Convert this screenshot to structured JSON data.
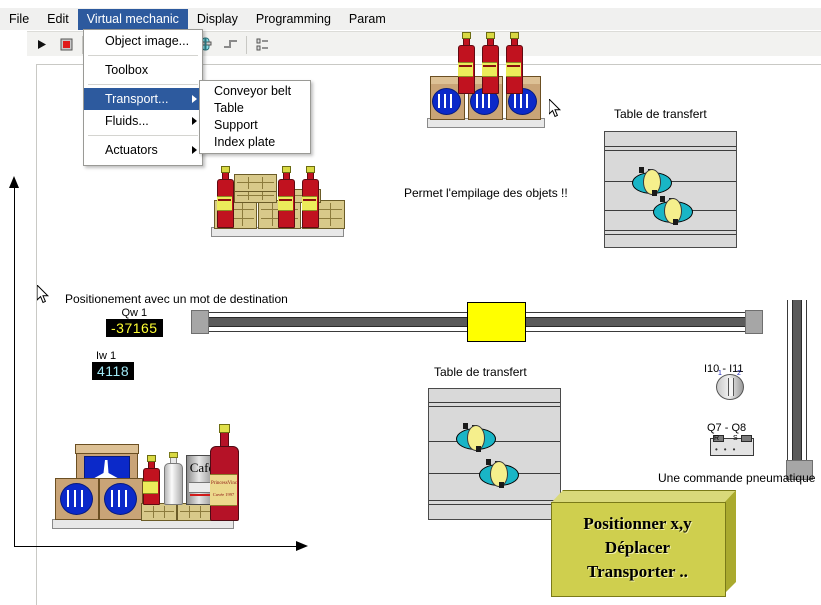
{
  "app": {
    "menubar": [
      {
        "label": "File",
        "active": false
      },
      {
        "label": "Edit",
        "active": false
      },
      {
        "label": "Virtual mechanic",
        "active": true
      },
      {
        "label": "Display",
        "active": false
      },
      {
        "label": "Programming",
        "active": false
      },
      {
        "label": "Param",
        "active": false
      }
    ]
  },
  "menus": {
    "virtual_mechanic": [
      {
        "label": "Object image...",
        "submenu": false,
        "highlighted": false
      },
      {
        "label": "Toolbox",
        "submenu": false,
        "highlighted": false
      },
      {
        "label": "Transport...",
        "submenu": true,
        "highlighted": true
      },
      {
        "label": "Fluids...",
        "submenu": true,
        "highlighted": false
      },
      {
        "label": "Actuators",
        "submenu": true,
        "highlighted": false
      }
    ],
    "transport": [
      {
        "label": "Conveyor belt"
      },
      {
        "label": "Table"
      },
      {
        "label": "Support"
      },
      {
        "label": "Index plate"
      }
    ]
  },
  "toolbar": {
    "icons": [
      {
        "name": "run-icon",
        "glyph": "▶"
      },
      {
        "name": "stop-icon",
        "glyph": "■"
      },
      {
        "name": "object-image-icon",
        "glyph": "▤"
      },
      {
        "name": "toolbox-icon",
        "glyph": "▥"
      },
      {
        "name": "conveyor-icon",
        "glyph": "☷"
      },
      {
        "name": "sort-icon",
        "glyph": "⧖"
      },
      {
        "name": "cylinder-icon",
        "glyph": "⌽"
      },
      {
        "name": "corner-icon",
        "glyph": "┐"
      },
      {
        "name": "list-icon",
        "glyph": "≣"
      }
    ]
  },
  "canvas": {
    "labels": {
      "stacking_note": "Permet l'empilage des objets !!",
      "positioning_note": "Positionement avec un mot de destination",
      "transfer_table_top": "Table de transfert",
      "transfer_table_bottom": "Table de transfert",
      "pneumatic_note": "Une commande pneumatique"
    },
    "value_displays": [
      {
        "caption": "Qw 1",
        "value": "-37165",
        "color": "#ffff33"
      },
      {
        "caption": "Iw 1",
        "value": "4118",
        "color": "#9fe8f5"
      }
    ],
    "io_labels": [
      {
        "name": "rotary-switch-label",
        "text": "I10 - I11"
      },
      {
        "name": "valve-label",
        "text": "Q7 - Q8"
      }
    ],
    "rotary_switch_marks": [
      "1",
      "2"
    ],
    "valve_port_labels": [
      "R",
      "S"
    ],
    "callout": {
      "lines": [
        "Positionner x,y",
        "Déplacer",
        "Transporter .."
      ],
      "face_color": "#cfcf4e",
      "top_color": "#d9d97a",
      "side_color": "#aaaa2e"
    },
    "product_labels": {
      "coffee_can": "Café",
      "wine_label": "PrincessVinc",
      "wine_sub": "Cuvée 1997"
    },
    "colors": {
      "menu_highlight": "#2d5a9e",
      "carriage": "#ffff00",
      "puck_body": "#19b5c6",
      "puck_core": "#f5ef8c",
      "crate": "#d8c98a",
      "bottle": "#c1121f",
      "disc": "#0b29c9"
    }
  }
}
